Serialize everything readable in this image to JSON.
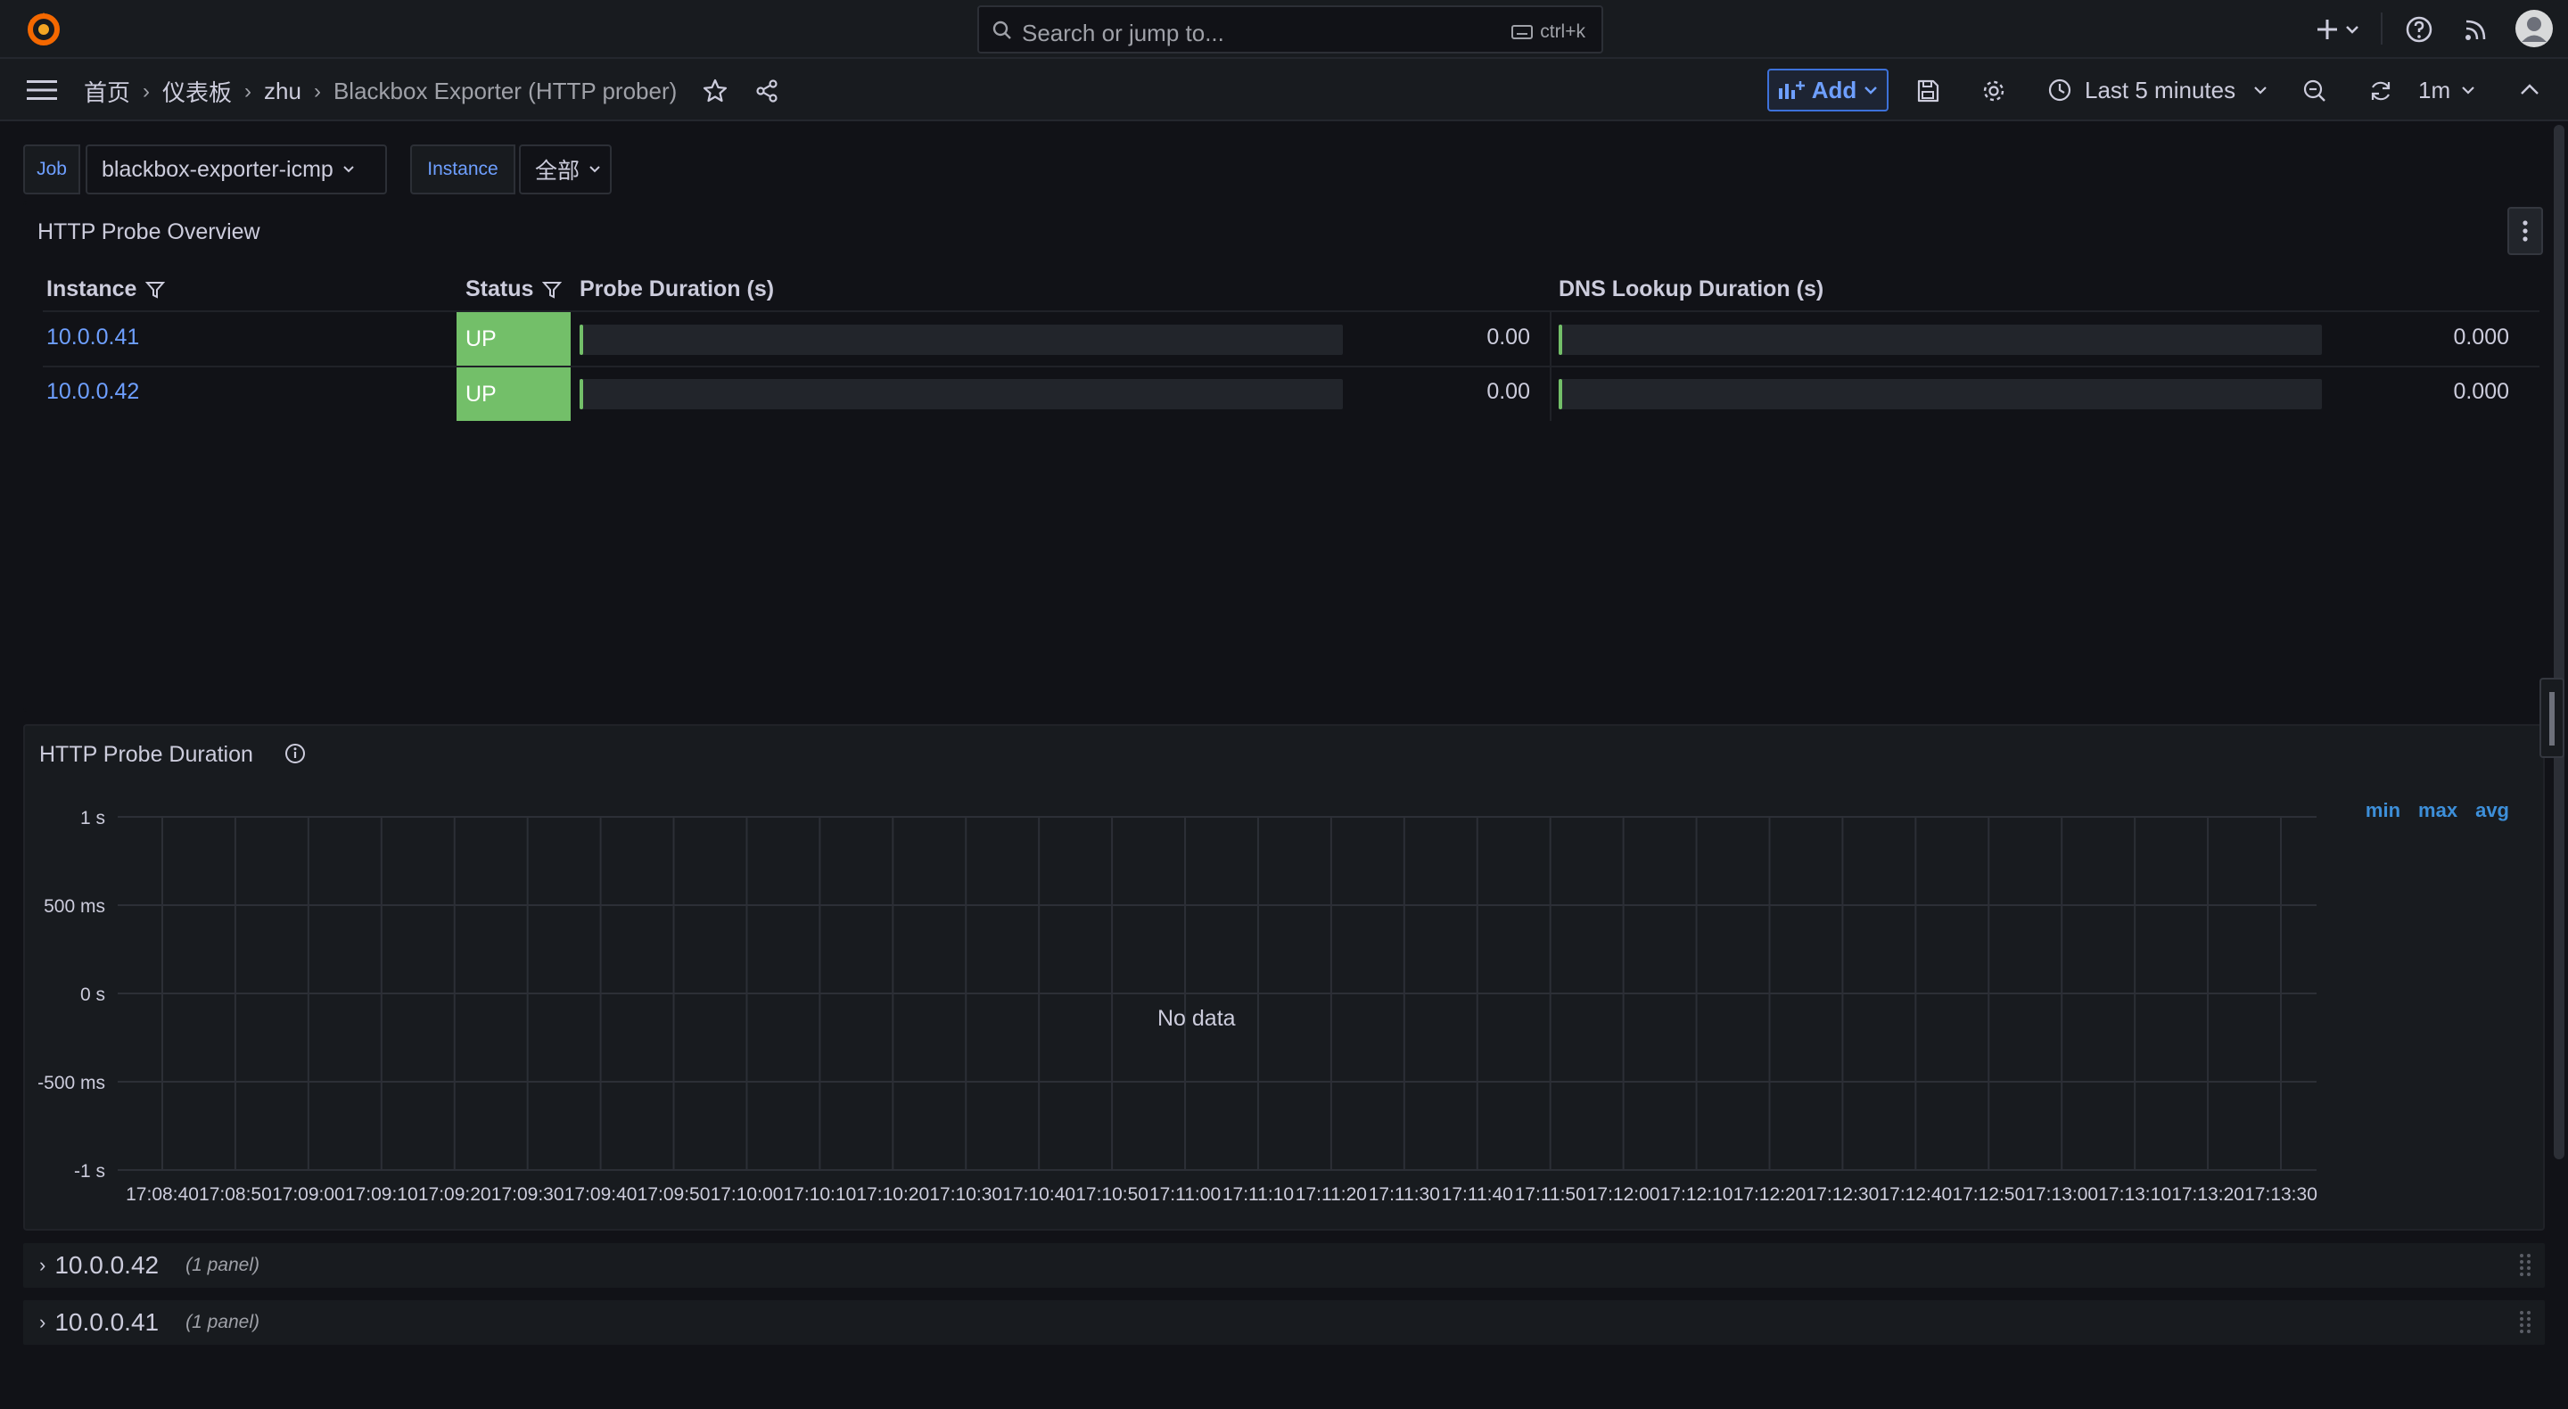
{
  "topbar": {
    "search_placeholder": "Search or jump to...",
    "search_shortcut": "ctrl+k"
  },
  "navbar": {
    "breadcrumb": [
      "首页",
      "仪表板",
      "zhu",
      "Blackbox Exporter (HTTP prober)"
    ],
    "add_label": "Add",
    "time_range": "Last 5 minutes",
    "refresh_interval": "1m"
  },
  "variables": {
    "job": {
      "label": "Job",
      "value": "blackbox-exporter-icmp"
    },
    "instance": {
      "label": "Instance",
      "value": "全部"
    }
  },
  "overview": {
    "title": "HTTP Probe Overview",
    "columns": {
      "instance": "Instance",
      "status": "Status",
      "probe_duration": "Probe Duration (s)",
      "dns_lookup": "DNS Lookup Duration (s)"
    },
    "rows": [
      {
        "instance": "10.0.0.41",
        "status": "UP",
        "probe_duration": "0.00",
        "dns_lookup": "0.000"
      },
      {
        "instance": "10.0.0.42",
        "status": "UP",
        "probe_duration": "0.00",
        "dns_lookup": "0.000"
      }
    ],
    "status_color": "#73bf69"
  },
  "duration_panel": {
    "title": "HTTP Probe Duration",
    "no_data": "No data",
    "legend_actions": [
      "min",
      "max",
      "avg"
    ]
  },
  "chart_data": {
    "type": "line",
    "title": "HTTP Probe Duration",
    "y_ticks": [
      "1 s",
      "500 ms",
      "0 s",
      "-500 ms",
      "-1 s"
    ],
    "ylim": [
      -1,
      1
    ],
    "x_ticks": [
      "17:08:40",
      "17:08:50",
      "17:09:00",
      "17:09:10",
      "17:09:20",
      "17:09:30",
      "17:09:40",
      "17:09:50",
      "17:10:00",
      "17:10:10",
      "17:10:20",
      "17:10:30",
      "17:10:40",
      "17:10:50",
      "17:11:00",
      "17:11:10",
      "17:11:20",
      "17:11:30",
      "17:11:40",
      "17:11:50",
      "17:12:00",
      "17:12:10",
      "17:12:20",
      "17:12:30",
      "17:12:40",
      "17:12:50",
      "17:13:00",
      "17:13:10",
      "17:13:20",
      "17:13:30"
    ],
    "series": [],
    "grid": true
  },
  "rows": [
    {
      "title": "10.0.0.42",
      "count": "(1 panel)"
    },
    {
      "title": "10.0.0.41",
      "count": "(1 panel)"
    }
  ],
  "colors": {
    "accent": "#6e9fff",
    "success": "#73bf69",
    "background": "#111217",
    "panel": "#181b1f"
  }
}
